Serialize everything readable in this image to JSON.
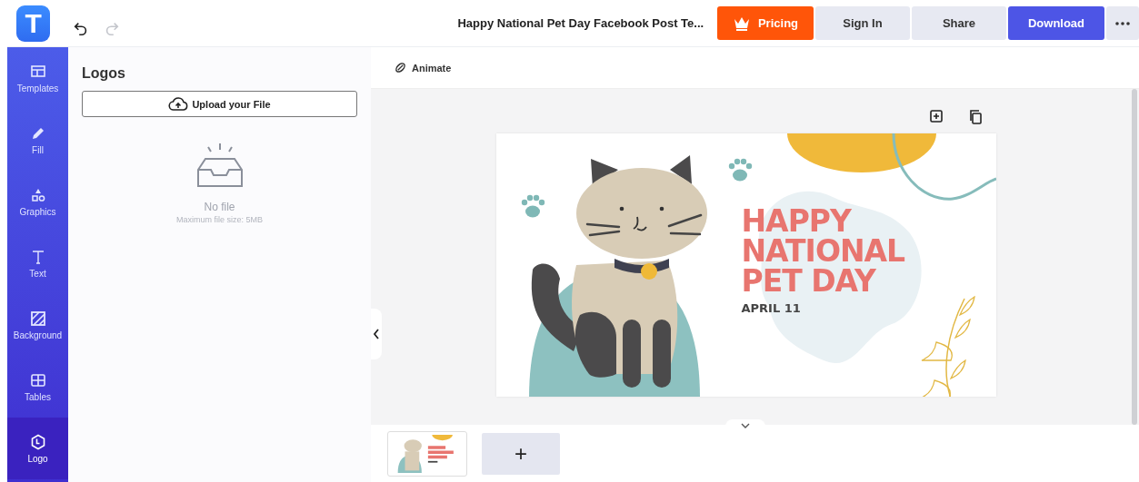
{
  "logo": {
    "letter": "T"
  },
  "history": {
    "undo": {
      "disabled": false
    },
    "redo": {
      "disabled": true
    }
  },
  "document_title": "Happy National Pet Day Facebook Post Te...",
  "header_buttons": [
    {
      "kind": "pricing",
      "label": "Pricing"
    },
    {
      "kind": "plain",
      "label": "Sign In"
    },
    {
      "kind": "plain",
      "label": "Share"
    },
    {
      "kind": "primary",
      "label": "Download"
    },
    {
      "kind": "more"
    }
  ],
  "sidebar": {
    "items": [
      {
        "label": "Templates",
        "selected": false
      },
      {
        "label": "Fill",
        "selected": false
      },
      {
        "label": "Graphics",
        "selected": false
      },
      {
        "label": "Text",
        "selected": false
      },
      {
        "label": "Background",
        "selected": false
      },
      {
        "label": "Tables",
        "selected": false
      },
      {
        "label": "Logo",
        "selected": true
      }
    ]
  },
  "panel": {
    "title": "Logos",
    "upload_button": "Upload your File",
    "empty_title": "No file",
    "empty_note": "Maximum file size: 5MB"
  },
  "canvas": {
    "animate_button": "Animate",
    "design": {
      "headline": [
        "HAPPY",
        "NATIONAL",
        "PET DAY"
      ],
      "date": "APRIL 11"
    }
  },
  "pages": {
    "add_button": "+"
  }
}
